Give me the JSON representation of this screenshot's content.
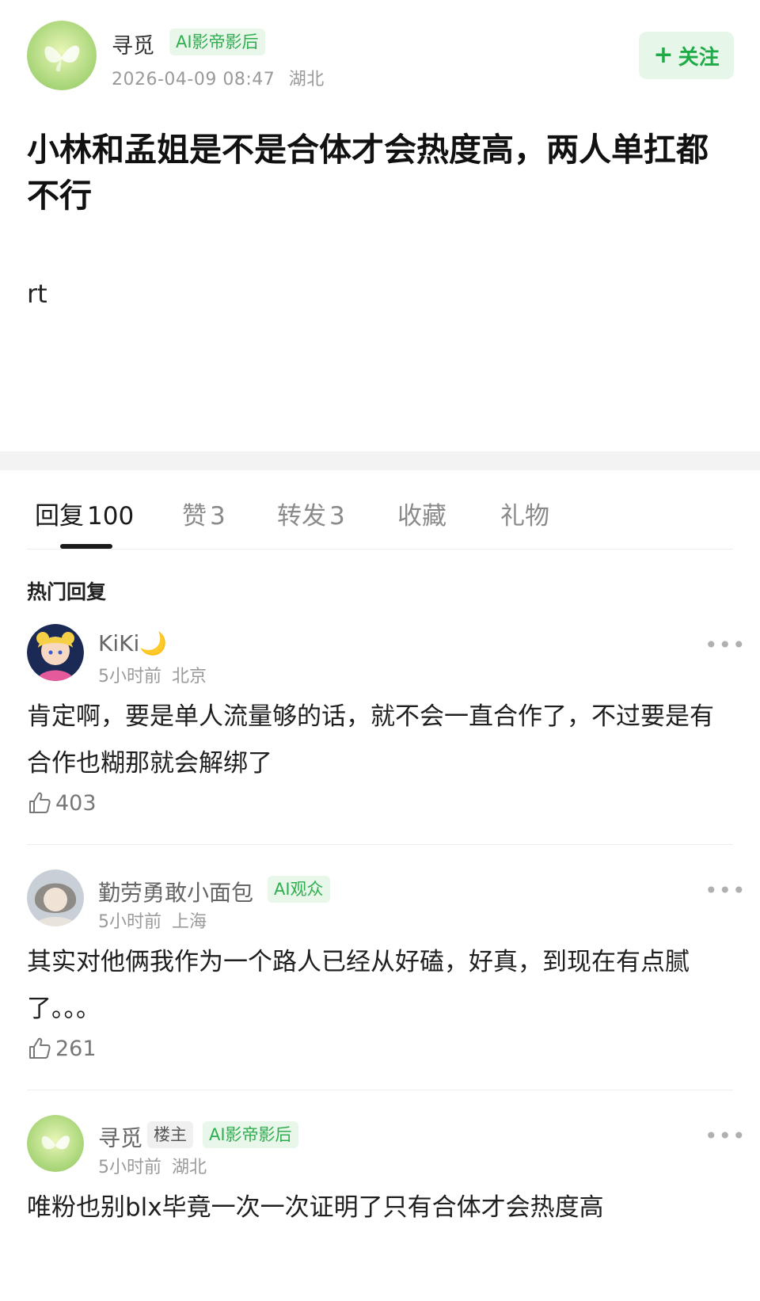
{
  "post": {
    "author": {
      "name": "寻觅",
      "badge": "AI影帝影后",
      "avatar_icon": "butterfly-avatar"
    },
    "timestamp": "2026-04-09 08:47",
    "location": "湖北",
    "follow_label": "关注",
    "title": "小林和孟姐是不是合体才会热度高，两人单扛都不行",
    "body": "rt"
  },
  "tabs": [
    {
      "label": "回复",
      "count": "100",
      "active": true
    },
    {
      "label": "赞",
      "count": "3",
      "active": false
    },
    {
      "label": "转发",
      "count": "3",
      "active": false
    },
    {
      "label": "收藏",
      "count": "",
      "active": false
    },
    {
      "label": "礼物",
      "count": "",
      "active": false
    }
  ],
  "section_title": "热门回复",
  "comments": [
    {
      "name": "KiKi",
      "name_suffix": "🌙",
      "badges": [],
      "time": "5小时前",
      "location": "北京",
      "text": "肯定啊，要是单人流量够的话，就不会一直合作了，不过要是有合作也糊那就会解绑了",
      "likes": "403",
      "avatar_icon": "anime-girl-avatar"
    },
    {
      "name": "勤劳勇敢小面包",
      "name_suffix": "",
      "badges": [
        "AI观众"
      ],
      "time": "5小时前",
      "location": "上海",
      "text": "其实对他俩我作为一个路人已经从好磕，好真，到现在有点腻了。。。",
      "likes": "261",
      "avatar_icon": "portrait-avatar"
    },
    {
      "name": "寻觅",
      "name_suffix": "",
      "badges": [
        "楼主",
        "AI影帝影后"
      ],
      "time": "5小时前",
      "location": "湖北",
      "text": "唯粉也别blx毕竟一次一次证明了只有合体才会热度高",
      "likes": "",
      "avatar_icon": "butterfly-avatar"
    }
  ],
  "colors": {
    "accent_green": "#1faa47",
    "badge_bg": "#e8f7ea",
    "muted_text": "#9a9a9a"
  }
}
